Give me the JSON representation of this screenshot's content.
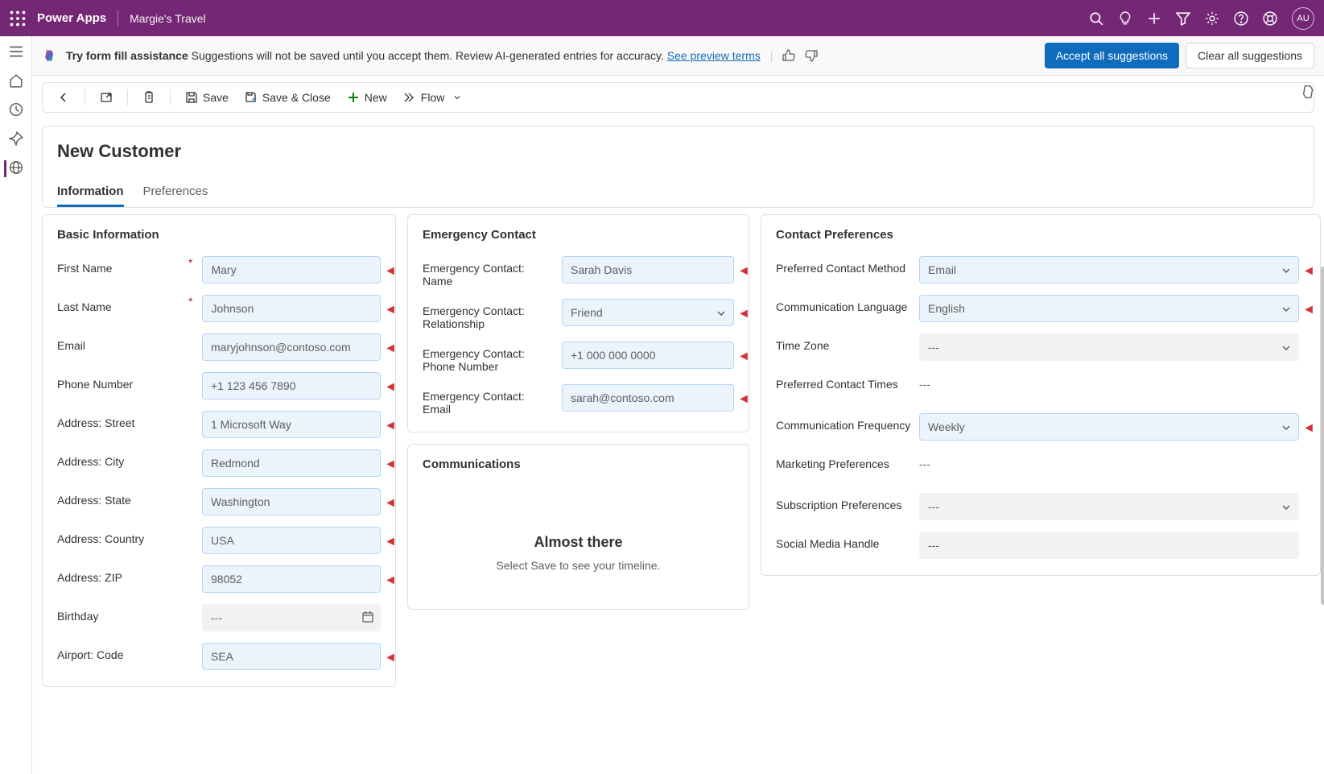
{
  "header": {
    "app": "Power Apps",
    "env": "Margie's Travel",
    "avatar": "AU"
  },
  "banner": {
    "title": "Try form fill assistance",
    "message": " Suggestions will not be saved until you accept them. Review AI-generated entries for accuracy. ",
    "link": "See preview terms",
    "accept": "Accept all suggestions",
    "clear": "Clear all suggestions"
  },
  "commands": {
    "save": "Save",
    "saveClose": "Save & Close",
    "new": "New",
    "flow": "Flow"
  },
  "page": {
    "title": "New Customer",
    "tabs": [
      "Information",
      "Preferences"
    ]
  },
  "sections": {
    "basic": {
      "title": "Basic Information",
      "fields": {
        "firstName": {
          "label": "First Name",
          "value": "Mary"
        },
        "lastName": {
          "label": "Last Name",
          "value": "Johnson"
        },
        "email": {
          "label": "Email",
          "value": "maryjohnson@contoso.com"
        },
        "phone": {
          "label": "Phone Number",
          "value": "+1 123 456 7890"
        },
        "street": {
          "label": "Address: Street",
          "value": "1 Microsoft Way"
        },
        "city": {
          "label": "Address: City",
          "value": "Redmond"
        },
        "state": {
          "label": "Address: State",
          "value": "Washington"
        },
        "country": {
          "label": "Address: Country",
          "value": "USA"
        },
        "zip": {
          "label": "Address: ZIP",
          "value": "98052"
        },
        "birthday": {
          "label": "Birthday",
          "value": "---"
        },
        "airport": {
          "label": "Airport: Code",
          "value": "SEA"
        }
      }
    },
    "emergency": {
      "title": "Emergency Contact",
      "fields": {
        "name": {
          "label": "Emergency Contact: Name",
          "value": "Sarah Davis"
        },
        "relationship": {
          "label": "Emergency Contact: Relationship",
          "value": "Friend"
        },
        "phone": {
          "label": "Emergency Contact: Phone Number",
          "value": "+1 000 000 0000"
        },
        "email": {
          "label": "Emergency Contact: Email",
          "value": "sarah@contoso.com"
        }
      }
    },
    "communications": {
      "title": "Communications",
      "timeline": {
        "heading": "Almost there",
        "sub": "Select Save to see your timeline."
      }
    },
    "contactPrefs": {
      "title": "Contact Preferences",
      "fields": {
        "method": {
          "label": "Preferred Contact Method",
          "value": "Email"
        },
        "lang": {
          "label": "Communication Language",
          "value": "English"
        },
        "tz": {
          "label": "Time Zone",
          "value": "---"
        },
        "times": {
          "label": "Preferred Contact Times",
          "value": "---"
        },
        "freq": {
          "label": "Communication Frequency",
          "value": "Weekly"
        },
        "marketing": {
          "label": "Marketing Preferences",
          "value": "---"
        },
        "subscription": {
          "label": "Subscription Preferences",
          "value": "---"
        },
        "social": {
          "label": "Social Media Handle",
          "value": "---"
        }
      }
    }
  }
}
